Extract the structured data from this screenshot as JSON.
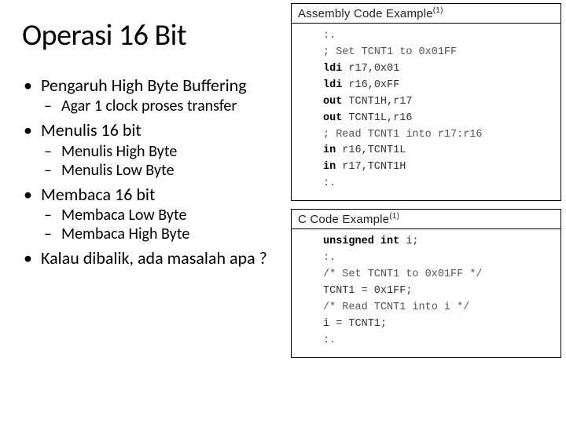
{
  "title": "Operasi 16 Bit",
  "bullets": {
    "b1": "Pengaruh High Byte Buffering",
    "b1_1": "Agar 1 clock proses transfer",
    "b2": "Menulis 16 bit",
    "b2_1": "Menulis High Byte",
    "b2_2": "Menulis Low Byte",
    "b3": "Membaca 16 bit",
    "b3_1": "Membaca Low Byte",
    "b3_2": "Membaca High Byte",
    "b4": "Kalau dibalik, ada masalah apa ?"
  },
  "asm": {
    "title": "Assembly Code Example",
    "sup": "(1)",
    "l1": ":.",
    "l2": "; Set TCNT1 to 0x01FF",
    "l3a": "ldi",
    "l3b": " r17,0x01",
    "l4a": "ldi",
    "l4b": " r16,0xFF",
    "l5a": "out",
    "l5b": " TCNT1H,r17",
    "l6a": "out",
    "l6b": " TCNT1L,r16",
    "l7": "; Read TCNT1 into r17:r16",
    "l8a": "in",
    "l8b": " r16,TCNT1L",
    "l9a": "in",
    "l9b": " r17,TCNT1H",
    "l10": ":."
  },
  "c": {
    "title": "C Code Example",
    "sup": "(1)",
    "l1a": "unsigned int",
    "l1b": " i;",
    "l2": ":.",
    "l3": "/* Set TCNT1 to 0x01FF */",
    "l4": "TCNT1 = 0x1FF;",
    "l5": "/* Read TCNT1 into i */",
    "l6": "i = TCNT1;",
    "l7": ":."
  }
}
